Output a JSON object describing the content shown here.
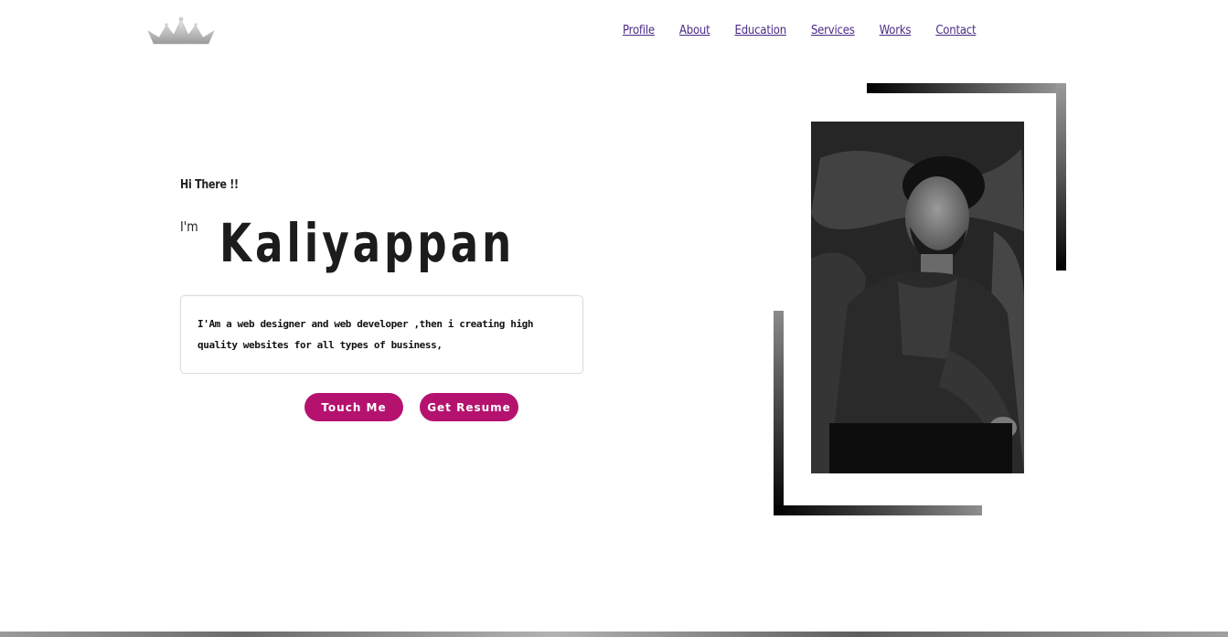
{
  "header": {
    "logo_icon": "crown-icon",
    "nav": [
      {
        "label": "Profile"
      },
      {
        "label": "About"
      },
      {
        "label": "Education"
      },
      {
        "label": "Services"
      },
      {
        "label": "Works"
      },
      {
        "label": "Contact"
      }
    ]
  },
  "hero": {
    "greeting": "Hi There !!",
    "im": "I'm",
    "name": "Kaliyappan",
    "bio": "I'Am a web designer and web developer ,then i creating high quality websites for all types of business,",
    "buttons": {
      "touch": "Touch Me",
      "resume": "Get Resume"
    }
  },
  "colors": {
    "accent": "#b5126f",
    "nav_link": "#4b2a86"
  }
}
